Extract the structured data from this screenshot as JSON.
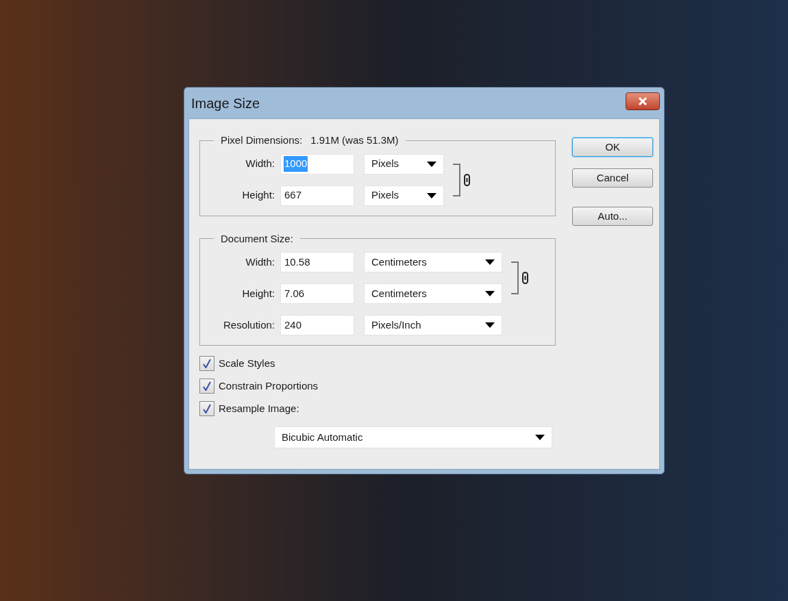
{
  "window": {
    "title": "Image Size"
  },
  "pixel_dimensions": {
    "label": "Pixel Dimensions:",
    "summary": "1.91M (was 51.3M)",
    "rows": [
      {
        "label": "Width:",
        "value": "1000",
        "selected": true,
        "unit": "Pixels",
        "linked": true
      },
      {
        "label": "Height:",
        "value": "667",
        "selected": false,
        "unit": "Pixels",
        "linked": true
      }
    ]
  },
  "document_size": {
    "label": "Document Size:",
    "rows": [
      {
        "label": "Width:",
        "value": "10.58",
        "selected": false,
        "unit": "Centimeters",
        "linked": true
      },
      {
        "label": "Height:",
        "value": "7.06",
        "selected": false,
        "unit": "Centimeters",
        "linked": true
      },
      {
        "label": "Resolution:",
        "value": "240",
        "selected": false,
        "unit": "Pixels/Inch",
        "linked": false
      }
    ]
  },
  "options": [
    {
      "label": "Scale Styles",
      "checked": true
    },
    {
      "label": "Constrain Proportions",
      "checked": true
    },
    {
      "label": "Resample Image:",
      "checked": true
    }
  ],
  "resample_method": "Bicubic Automatic",
  "buttons": [
    {
      "label": "OK",
      "default": true
    },
    {
      "label": "Cancel",
      "default": false
    },
    {
      "label": "Auto...",
      "default": false
    }
  ]
}
